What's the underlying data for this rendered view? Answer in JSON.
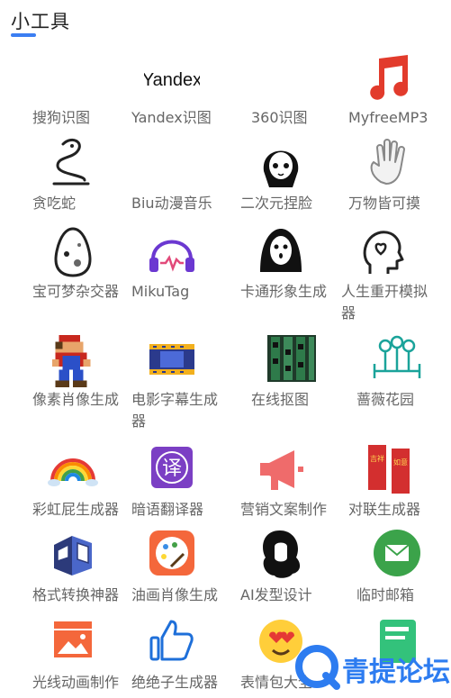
{
  "header": {
    "title": "小工具"
  },
  "tools": [
    {
      "label": "搜狗识图",
      "icon": "sogou-image-search-icon"
    },
    {
      "label": "Yandex识图",
      "icon": "yandex-logo",
      "icon_text": "Yandex"
    },
    {
      "label": "360识图",
      "icon": "blank-icon"
    },
    {
      "label": "MyfreeMP3",
      "icon": "music-note-icon"
    },
    {
      "label": "贪吃蛇",
      "icon": "snake-icon"
    },
    {
      "label": "Biu动漫音乐",
      "icon": "blank-icon"
    },
    {
      "label": "二次元捏脸",
      "icon": "anime-face-icon"
    },
    {
      "label": "万物皆可摸",
      "icon": "hand-icon"
    },
    {
      "label": "宝可梦杂交器",
      "icon": "egg-icon"
    },
    {
      "label": "MikuTag",
      "icon": "headphones-icon"
    },
    {
      "label": "卡通形象生成",
      "icon": "ghost-mask-icon"
    },
    {
      "label": "人生重开模拟器",
      "icon": "head-heart-icon"
    },
    {
      "label": "像素肖像生成",
      "icon": "pixel-mario-icon"
    },
    {
      "label": "电影字幕生成器",
      "icon": "film-icon"
    },
    {
      "label": "在线抠图",
      "icon": "film-strip-icon"
    },
    {
      "label": "蔷薇花园",
      "icon": "garden-icon"
    },
    {
      "label": "彩虹屁生成器",
      "icon": "rainbow-icon"
    },
    {
      "label": "暗语翻译器",
      "icon": "translate-icon",
      "icon_text": "译"
    },
    {
      "label": "营销文案制作",
      "icon": "megaphone-icon"
    },
    {
      "label": "对联生成器",
      "icon": "couplet-icon",
      "icon_text_left": "吉祥",
      "icon_text_right": "如意"
    },
    {
      "label": "格式转换神器",
      "icon": "cube-convert-icon"
    },
    {
      "label": "油画肖像生成",
      "icon": "palette-icon"
    },
    {
      "label": "AI发型设计",
      "icon": "hair-icon"
    },
    {
      "label": "临时邮箱",
      "icon": "mail-icon"
    },
    {
      "label": "光线动画制作",
      "icon": "image-icon"
    },
    {
      "label": "绝绝子生成器",
      "icon": "thumbs-up-icon"
    },
    {
      "label": "表情包大全",
      "icon": "emoji-icon"
    },
    {
      "label": "",
      "icon": "green-book-icon"
    }
  ],
  "watermark": {
    "text": "青提论坛",
    "color": "#2d7cf0"
  },
  "colors": {
    "accent": "#3b7ef2",
    "label": "#666666",
    "red": "#e23b2c"
  }
}
